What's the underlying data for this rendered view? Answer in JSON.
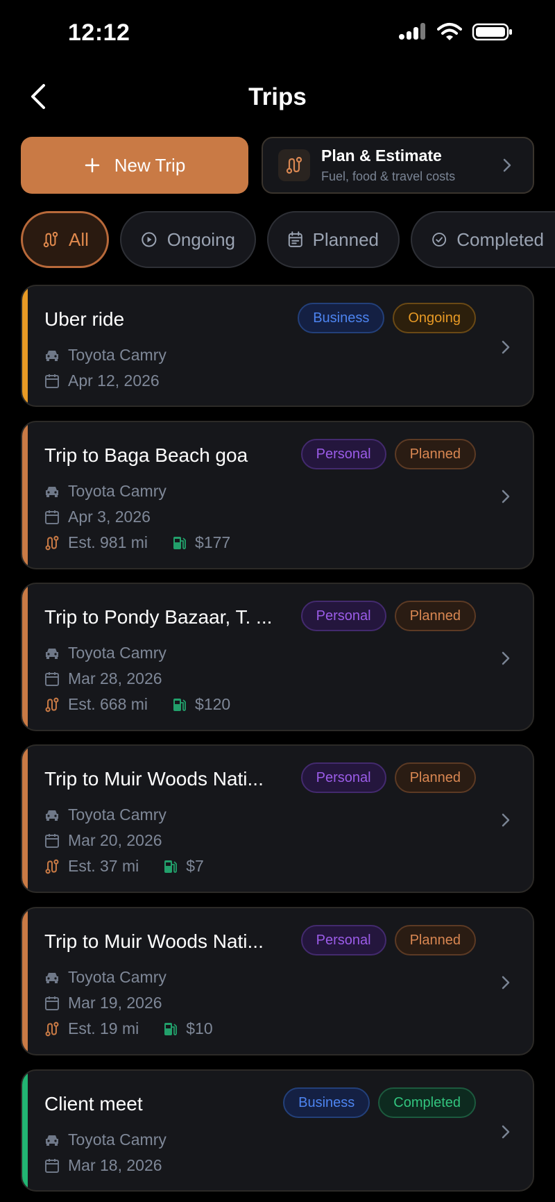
{
  "status_bar": {
    "time": "12:12"
  },
  "header": {
    "title": "Trips"
  },
  "actions": {
    "new_trip_label": "New Trip",
    "plan_title": "Plan & Estimate",
    "plan_subtitle": "Fuel, food & travel costs"
  },
  "filters": [
    {
      "label": "All",
      "icon": "route-icon",
      "active": true
    },
    {
      "label": "Ongoing",
      "icon": "play-circle-icon",
      "active": false
    },
    {
      "label": "Planned",
      "icon": "calendar-icon",
      "active": false
    },
    {
      "label": "Completed",
      "icon": "check-circle-icon",
      "active": false
    }
  ],
  "colors": {
    "accent": "#c97a45",
    "ongoing": "#e89a25",
    "planned": "#c97a45",
    "completed": "#22b573"
  },
  "trips": [
    {
      "title": "Uber ride",
      "category": "Business",
      "status": "Ongoing",
      "vehicle": "Toyota Camry",
      "date": "Apr 12, 2026"
    },
    {
      "title": "Trip to Baga Beach goa",
      "category": "Personal",
      "status": "Planned",
      "vehicle": "Toyota Camry",
      "date": "Apr 3, 2026",
      "distance": "Est. 981 mi",
      "fuel": "$177"
    },
    {
      "title": "Trip to Pondy Bazaar, T. ...",
      "category": "Personal",
      "status": "Planned",
      "vehicle": "Toyota Camry",
      "date": "Mar 28, 2026",
      "distance": "Est. 668 mi",
      "fuel": "$120"
    },
    {
      "title": "Trip to Muir Woods Nati...",
      "category": "Personal",
      "status": "Planned",
      "vehicle": "Toyota Camry",
      "date": "Mar 20, 2026",
      "distance": "Est. 37 mi",
      "fuel": "$7"
    },
    {
      "title": "Trip to Muir Woods Nati...",
      "category": "Personal",
      "status": "Planned",
      "vehicle": "Toyota Camry",
      "date": "Mar 19, 2026",
      "distance": "Est. 19 mi",
      "fuel": "$10"
    },
    {
      "title": "Client meet",
      "category": "Business",
      "status": "Completed",
      "vehicle": "Toyota Camry",
      "date": "Mar 18, 2026"
    }
  ]
}
